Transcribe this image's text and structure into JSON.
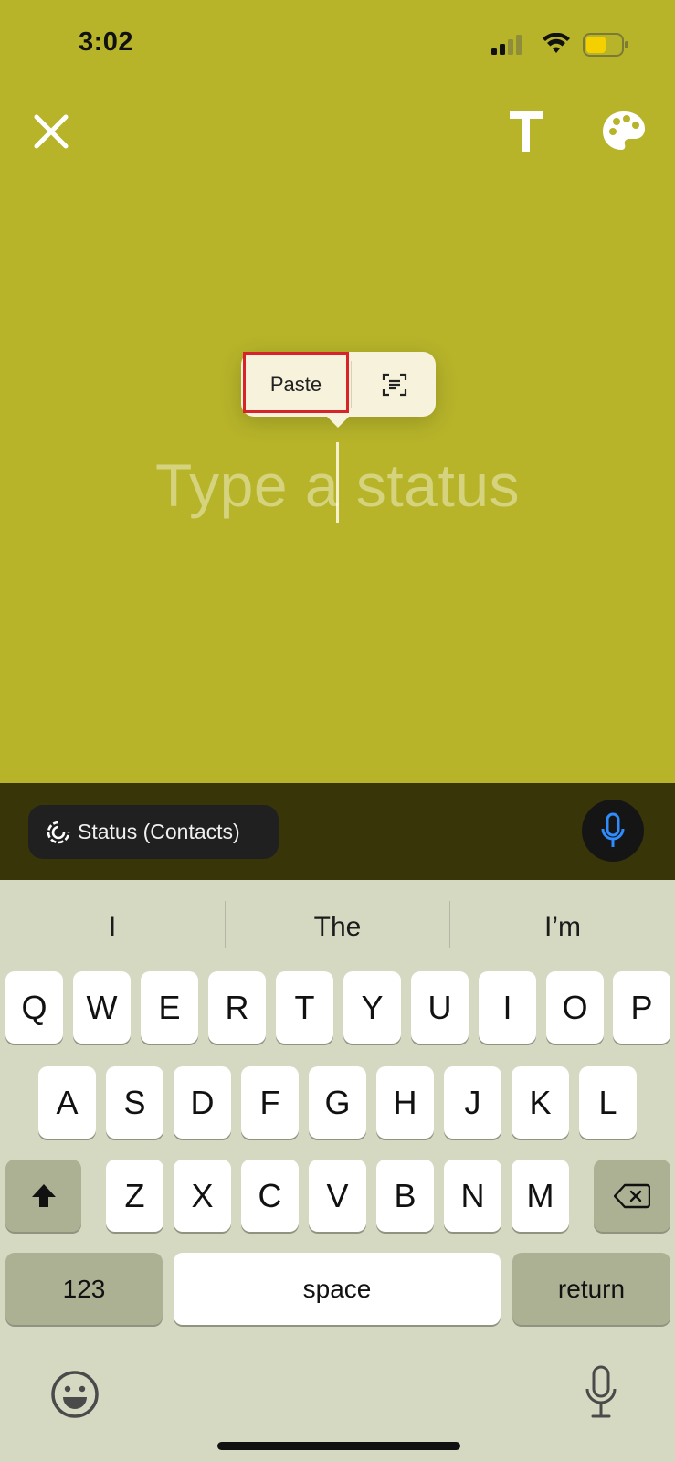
{
  "status_bar": {
    "time": "3:02"
  },
  "popover": {
    "paste_label": "Paste"
  },
  "composer": {
    "placeholder": "Type a status"
  },
  "bottom_bar": {
    "privacy_label": "Status (Contacts)"
  },
  "keyboard": {
    "suggestions": [
      "I",
      "The",
      "I’m"
    ],
    "row1": [
      "Q",
      "W",
      "E",
      "R",
      "T",
      "Y",
      "U",
      "I",
      "O",
      "P"
    ],
    "row2": [
      "A",
      "S",
      "D",
      "F",
      "G",
      "H",
      "J",
      "K",
      "L"
    ],
    "row3": [
      "Z",
      "X",
      "C",
      "V",
      "B",
      "N",
      "M"
    ],
    "numbers_label": "123",
    "space_label": "space",
    "return_label": "return"
  },
  "colors": {
    "background": "#b7b42a",
    "bottom_bar": "#383509",
    "highlight": "#d8232a",
    "mic_blue": "#2f8cff"
  },
  "icons": [
    "close-icon",
    "text-style-icon",
    "palette-icon",
    "scan-text-icon",
    "status-privacy-icon",
    "microphone-icon",
    "shift-icon",
    "backspace-icon",
    "emoji-icon",
    "dictation-icon"
  ]
}
